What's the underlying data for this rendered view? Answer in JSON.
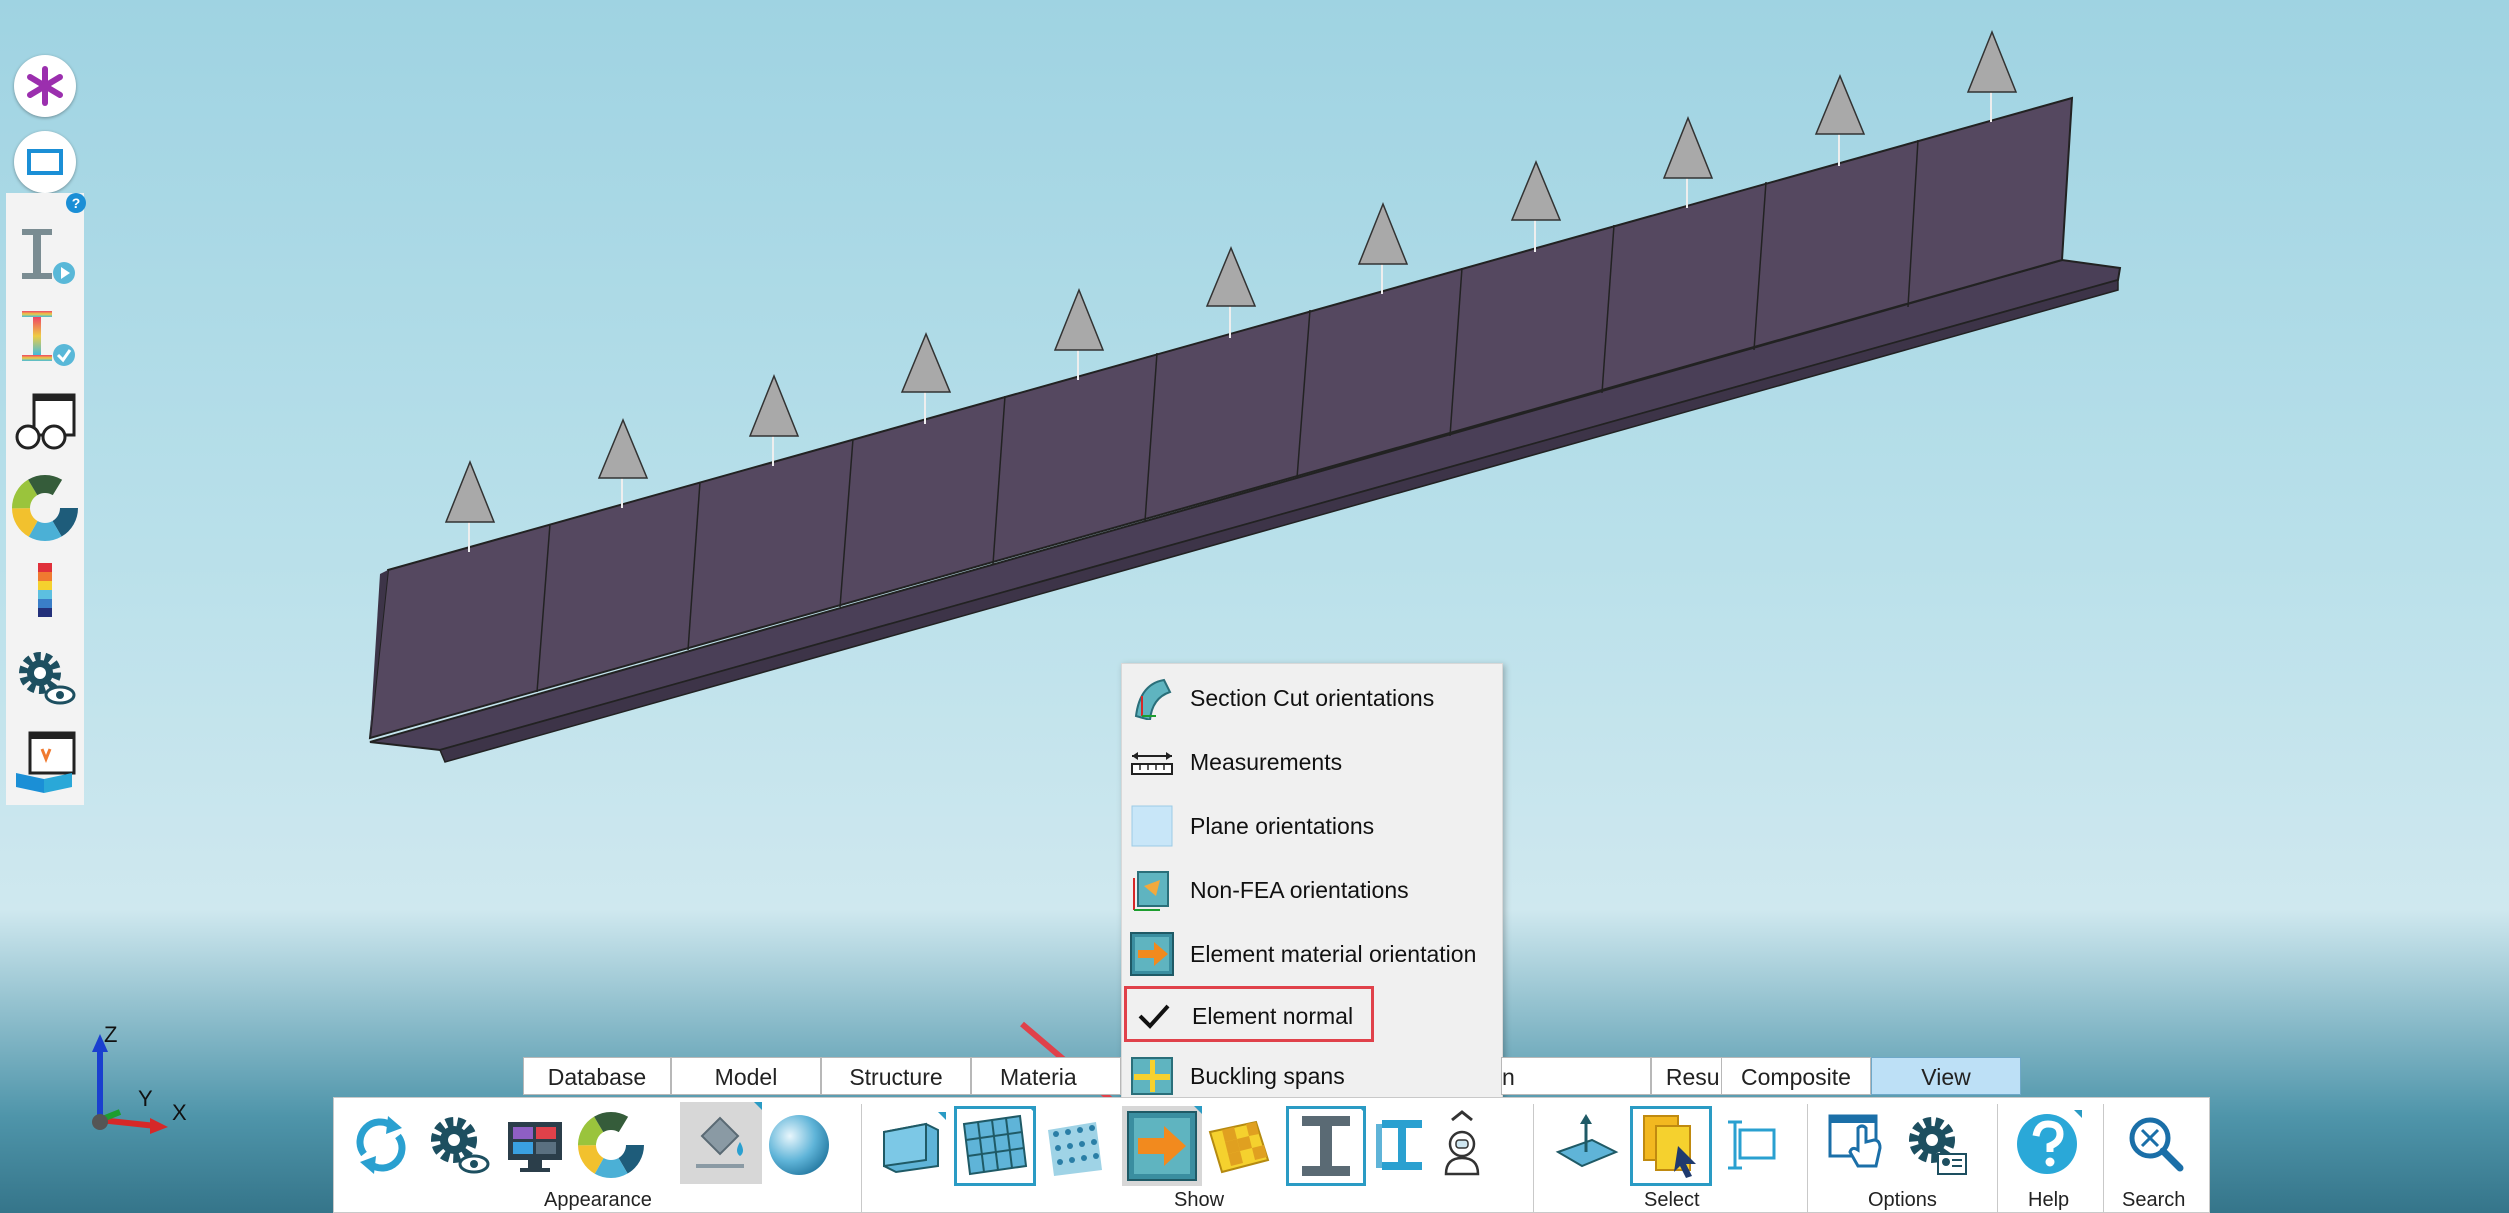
{
  "context_menu": {
    "items": [
      {
        "label": "Section Cut orientations",
        "icon": "section-cut-icon",
        "checked": false
      },
      {
        "label": "Measurements",
        "icon": "ruler-icon",
        "checked": false
      },
      {
        "label": "Plane orientations",
        "icon": "plane-icon",
        "checked": false
      },
      {
        "label": "Non-FEA orientations",
        "icon": "non-fea-icon",
        "checked": false
      },
      {
        "label": "Element material orientation",
        "icon": "orange-arrow-icon",
        "checked": false
      },
      {
        "label": "Element normal",
        "icon": "checkmark-icon",
        "checked": true
      },
      {
        "label": "Buckling spans",
        "icon": "buckling-icon",
        "checked": false
      }
    ]
  },
  "tabs": [
    {
      "label": "Database"
    },
    {
      "label": "Model"
    },
    {
      "label": "Structure"
    },
    {
      "label": "Materia"
    },
    {
      "label": "n"
    },
    {
      "label": "Result"
    },
    {
      "label": "Composite"
    },
    {
      "label": "View",
      "active": true
    }
  ],
  "ribbon": {
    "groups": [
      {
        "label": "Appearance"
      },
      {
        "label": "Show"
      },
      {
        "label": "Select"
      },
      {
        "label": "Options"
      },
      {
        "label": "Help"
      },
      {
        "label": "Search"
      }
    ]
  },
  "axis": {
    "z": "Z",
    "y": "Y",
    "x": "X"
  },
  "left_toolbar": {
    "help_badge": "?"
  },
  "colors": {
    "beam": "#554860",
    "accent": "#2a9bc4",
    "annotation": "#e0414a"
  }
}
